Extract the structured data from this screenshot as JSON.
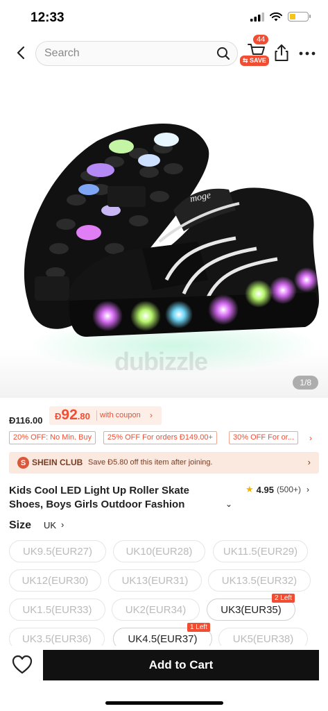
{
  "status_bar": {
    "time": "12:33"
  },
  "nav": {
    "search_placeholder": "Search",
    "cart_count": "44",
    "save_tag": "SAVE"
  },
  "image": {
    "counter": "1/8",
    "watermark": "dubizzle",
    "shoe_brand_text": "moge"
  },
  "price": {
    "original": "Đ116.00",
    "currency": "Đ",
    "coupon_price_main": "92",
    "coupon_price_cents": ".80",
    "coupon_label": "with coupon"
  },
  "promos": [
    "20% OFF: No Min. Buy",
    "25% OFF For orders Đ149.00+",
    "30% OFF For or..."
  ],
  "club": {
    "logo": "S",
    "name": "SHEIN CLUB",
    "text": "Save Đ5.80 off this item after joining."
  },
  "product": {
    "title": "Kids Cool LED Light Up Roller Skate Shoes, Boys Girls Outdoor Fashion Adjustable Wh",
    "rating": "4.95",
    "rating_count": "(500+)"
  },
  "size": {
    "label": "Size",
    "unit": "UK",
    "options": [
      {
        "label": "UK9.5(EUR27)",
        "available": false
      },
      {
        "label": "UK10(EUR28)",
        "available": false
      },
      {
        "label": "UK11.5(EUR29)",
        "available": false
      },
      {
        "label": "UK12(EUR30)",
        "available": false
      },
      {
        "label": "UK13(EUR31)",
        "available": false
      },
      {
        "label": "UK13.5(EUR32)",
        "available": false
      },
      {
        "label": "UK1.5(EUR33)",
        "available": false
      },
      {
        "label": "UK2(EUR34)",
        "available": false
      },
      {
        "label": "UK3(EUR35)",
        "available": true,
        "badge": "2 Left"
      },
      {
        "label": "UK3.5(EUR36)",
        "available": false
      },
      {
        "label": "UK4.5(EUR37)",
        "available": true,
        "badge": "1 Left"
      },
      {
        "label": "UK5(EUR38)",
        "available": false
      }
    ]
  },
  "bottom": {
    "add_to_cart": "Add to Cart"
  },
  "colors": {
    "accent": "#f04d32",
    "club_bg": "#fbe9df",
    "button_bg": "#111111"
  }
}
